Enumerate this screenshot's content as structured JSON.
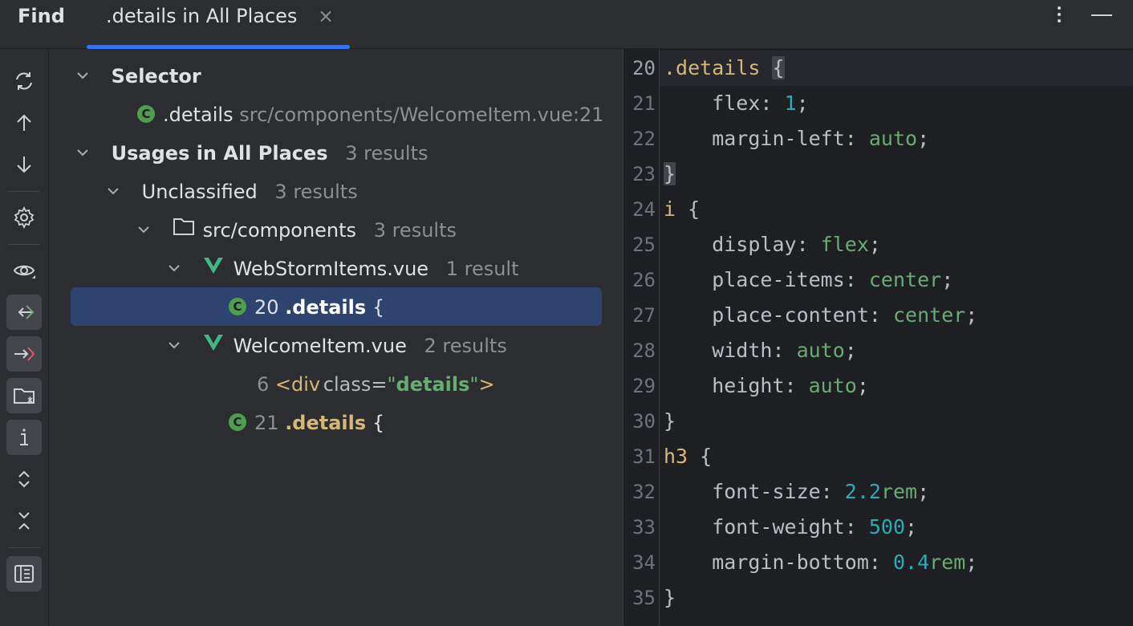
{
  "header": {
    "find_label": "Find",
    "tab_label": ".details in All Places",
    "tab_close": "×"
  },
  "toolbar": {
    "items": [
      "rerun-icon",
      "previous-occurrence-icon",
      "next-occurrence-icon",
      "settings-icon",
      "preview-icon",
      "read-access-icon",
      "write-access-icon",
      "group-by-directory-icon",
      "info-icon",
      "expand-all-icon",
      "collapse-all-icon",
      "show-preview-panel-icon"
    ]
  },
  "tree": {
    "selector_label": "Selector",
    "selector_item_name": ".details",
    "selector_item_path": "src/components/WelcomeItem.vue:21",
    "usages_label": "Usages in All Places",
    "usages_count": "3 results",
    "unclassified_label": "Unclassified",
    "unclassified_count": "3 results",
    "folder_label": "src/components",
    "folder_count": "3 results",
    "file1_name": "WebStormItems.vue",
    "file1_count": "1 result",
    "file1_match_line": "20",
    "file1_match_sel": ".details",
    "file1_match_brace": "{",
    "file2_name": "WelcomeItem.vue",
    "file2_count": "2 results",
    "file2_match1_line": "6",
    "file2_match1_tag": "<div",
    "file2_match1_attr": "class=",
    "file2_match1_q1": "\"",
    "file2_match1_str": "details",
    "file2_match1_q2": "\"",
    "file2_match1_close": ">",
    "file2_match2_line": "21",
    "file2_match2_sel": ".details",
    "file2_match2_brace": "{"
  },
  "editor": {
    "lines": [
      {
        "n": "20",
        "a": ".details",
        "b": " ",
        "c": "{"
      },
      {
        "n": "21",
        "a": "    flex: ",
        "b": "1",
        "c": ";"
      },
      {
        "n": "22",
        "a": "    margin-left: ",
        "b": "auto",
        "c": ";"
      },
      {
        "n": "23",
        "a": "}",
        "b": "",
        "c": ""
      },
      {
        "n": "24",
        "a": "i",
        "b": " {",
        "c": ""
      },
      {
        "n": "25",
        "a": "    display: ",
        "b": "flex",
        "c": ";"
      },
      {
        "n": "26",
        "a": "    place-items: ",
        "b": "center",
        "c": ";"
      },
      {
        "n": "27",
        "a": "    place-content: ",
        "b": "center",
        "c": ";"
      },
      {
        "n": "28",
        "a": "    width: ",
        "b": "auto",
        "c": ";"
      },
      {
        "n": "29",
        "a": "    height: ",
        "b": "auto",
        "c": ";"
      },
      {
        "n": "30",
        "a": "}",
        "b": "",
        "c": ""
      },
      {
        "n": "31",
        "a": "h3",
        "b": " {",
        "c": ""
      },
      {
        "n": "32",
        "a": "    font-size: ",
        "b": "2.2",
        "c": "rem",
        "d": ";"
      },
      {
        "n": "33",
        "a": "    font-weight: ",
        "b": "500",
        "c": ";"
      },
      {
        "n": "34",
        "a": "    margin-bottom: ",
        "b": "0.4",
        "c": "rem",
        "d": ";"
      },
      {
        "n": "35",
        "a": "}",
        "b": "",
        "c": ""
      }
    ]
  }
}
